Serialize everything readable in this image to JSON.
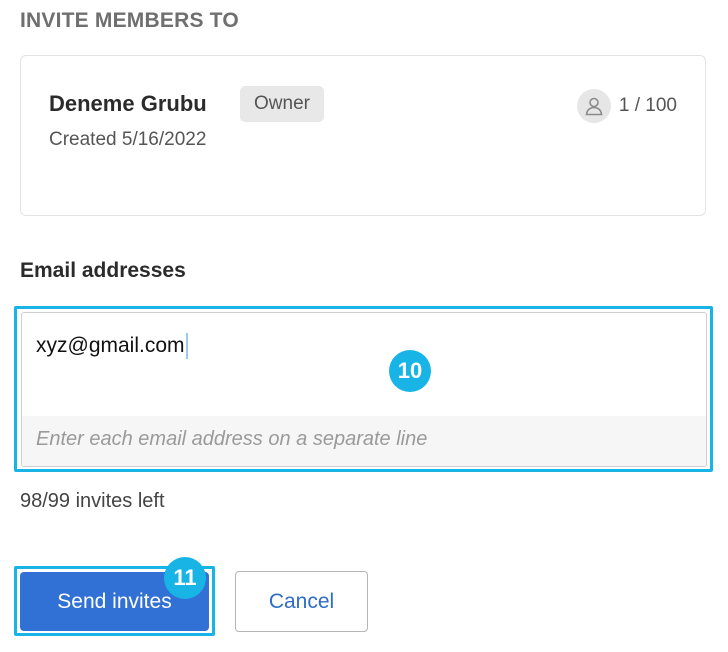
{
  "header": {
    "title": "INVITE MEMBERS TO"
  },
  "group": {
    "name": "Deneme Grubu",
    "role_badge": "Owner",
    "created": "Created 5/16/2022",
    "member_count": "1 / 100",
    "member_icon": "user-icon"
  },
  "email": {
    "label": "Email addresses",
    "value": "xyz@gmail.com",
    "hint": "Enter each email address on a separate line"
  },
  "invites_left": "98/99 invites left",
  "actions": {
    "send_label": "Send invites",
    "cancel_label": "Cancel"
  },
  "markers": {
    "email_step": "10",
    "send_step": "11"
  },
  "colors": {
    "accent": "#3170d4",
    "highlight": "#18b4e6",
    "badge_bg": "#e8e8e8"
  }
}
